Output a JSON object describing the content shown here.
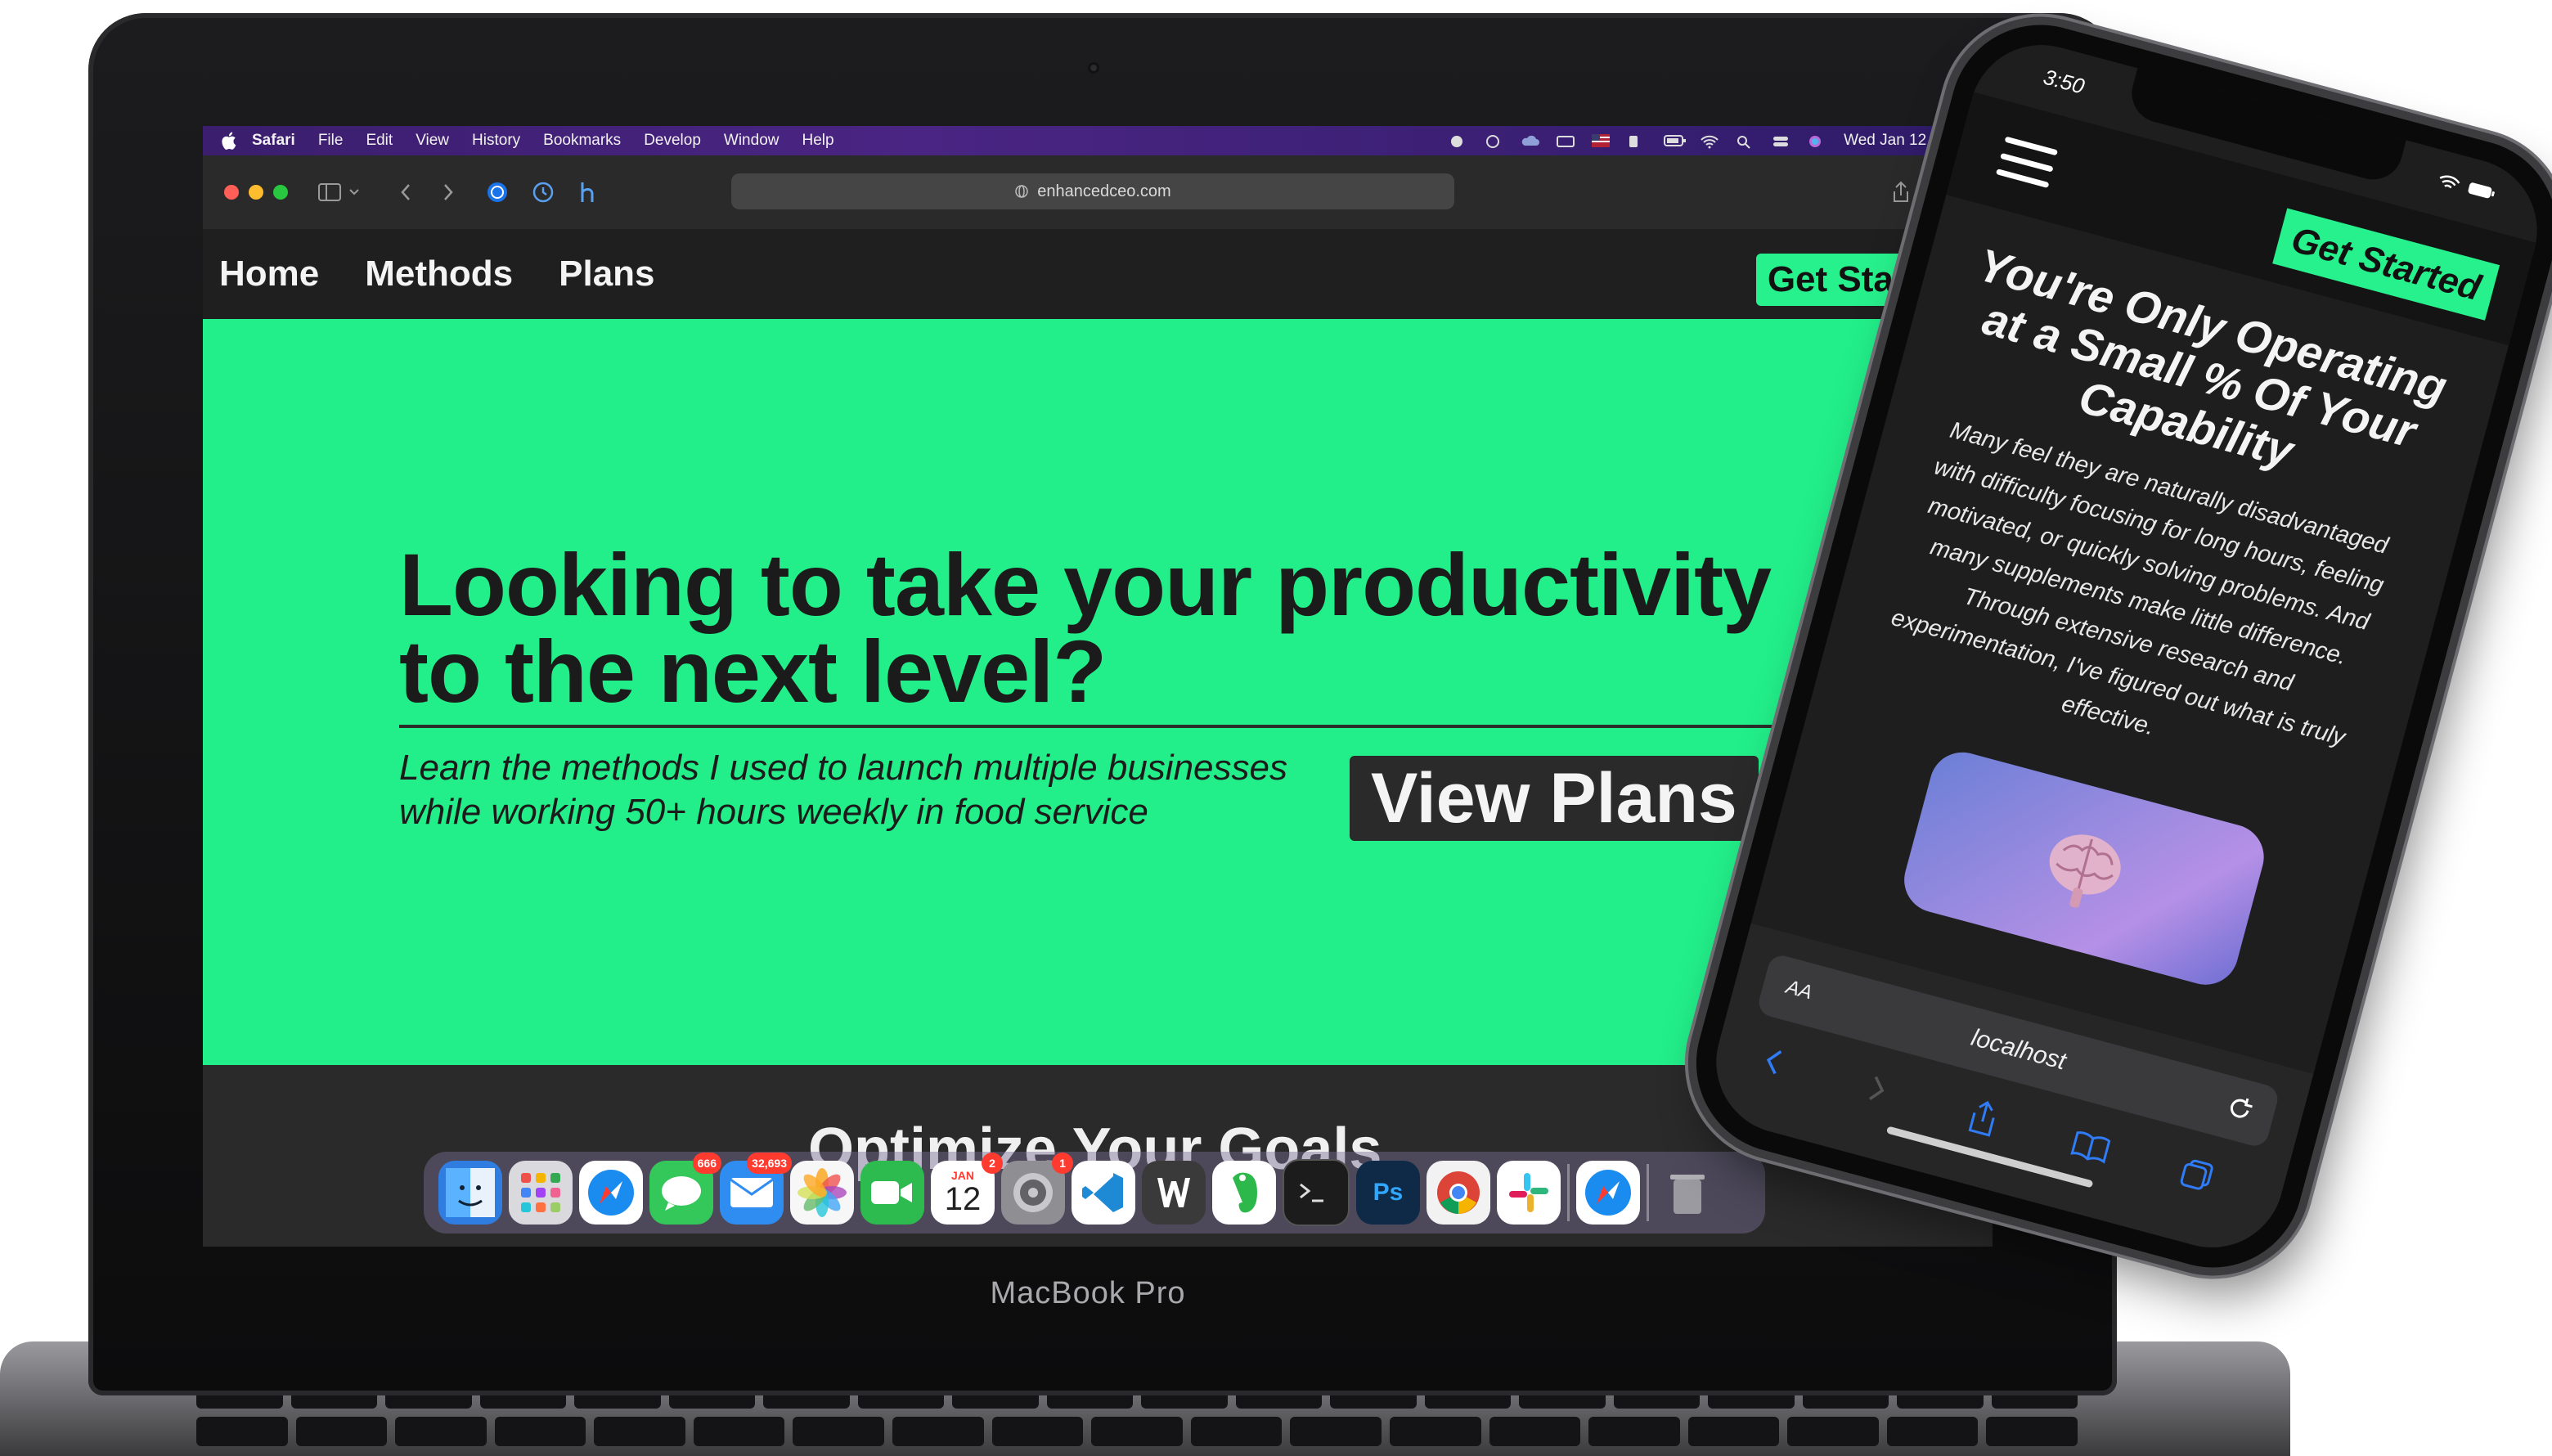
{
  "laptop": {
    "brand": "MacBook Pro",
    "menubar": {
      "app": "Safari",
      "items": [
        "File",
        "Edit",
        "View",
        "History",
        "Bookmarks",
        "Develop",
        "Window",
        "Help"
      ],
      "datetime": "Wed Jan 12  15:48"
    },
    "browser": {
      "url": "enhancedceo.com"
    },
    "site": {
      "nav": {
        "home": "Home",
        "methods": "Methods",
        "plans": "Plans",
        "cta": "Get Started"
      },
      "hero": {
        "headline": "Looking to take your productivity to the next level?",
        "subtext": "Learn the methods I used to launch multiple businesses while working 50+ hours weekly in food service",
        "button": "View Plans"
      },
      "section_title": "Optimize Your Goals"
    },
    "dock": {
      "apps": [
        {
          "name": "finder",
          "color": "#2f7de1",
          "badge": ""
        },
        {
          "name": "launchpad",
          "color": "#d9d9de",
          "badge": ""
        },
        {
          "name": "safari",
          "color": "#1a8cf0",
          "badge": ""
        },
        {
          "name": "messages",
          "color": "#34c759",
          "badge": "666"
        },
        {
          "name": "mail",
          "color": "#2f8cf0",
          "badge": "32,693"
        },
        {
          "name": "photos",
          "color": "#f2f2f2",
          "badge": ""
        },
        {
          "name": "facetime",
          "color": "#2dbb4f",
          "badge": ""
        },
        {
          "name": "calendar",
          "color": "#ffffff",
          "badge": "2"
        },
        {
          "name": "system-preferences",
          "color": "#8e8e93",
          "badge": "1"
        },
        {
          "name": "vscode",
          "color": "#1e8ad6",
          "badge": ""
        },
        {
          "name": "webstorm",
          "color": "#3a3a3a",
          "badge": ""
        },
        {
          "name": "evernote",
          "color": "#2db84c",
          "badge": ""
        },
        {
          "name": "terminal",
          "color": "#1c1c1c",
          "badge": ""
        },
        {
          "name": "photoshop",
          "color": "#0e2a47",
          "badge": ""
        },
        {
          "name": "chrome",
          "color": "#f2f2f2",
          "badge": ""
        },
        {
          "name": "slack",
          "color": "#ffffff",
          "badge": ""
        },
        {
          "name": "safari-recent",
          "color": "#1a8cf0",
          "badge": ""
        },
        {
          "name": "trash",
          "color": "#9a9aa0",
          "badge": ""
        }
      ],
      "calendar_month": "JAN",
      "calendar_day": "12",
      "photoshop_label": "Ps"
    }
  },
  "phone": {
    "time": "3:50",
    "cta": "Get Started",
    "heading": "You're Only Operating at a Small % Of Your Capability",
    "body": "Many feel they are naturally disadvantaged with difficulty focusing for long hours, feeling motivated, or quickly solving problems. And many supplements make little difference. Through extensive research and experimentation, I've figured out what is truly effective.",
    "safari": {
      "aa": "AA",
      "url": "localhost"
    }
  },
  "colors": {
    "accent_green": "#27f18c",
    "hero_green": "#22ef89",
    "dark_bg": "#1e1e1e",
    "menubar_purple": "#4a2583",
    "ios_blue": "#2f7cf6"
  }
}
